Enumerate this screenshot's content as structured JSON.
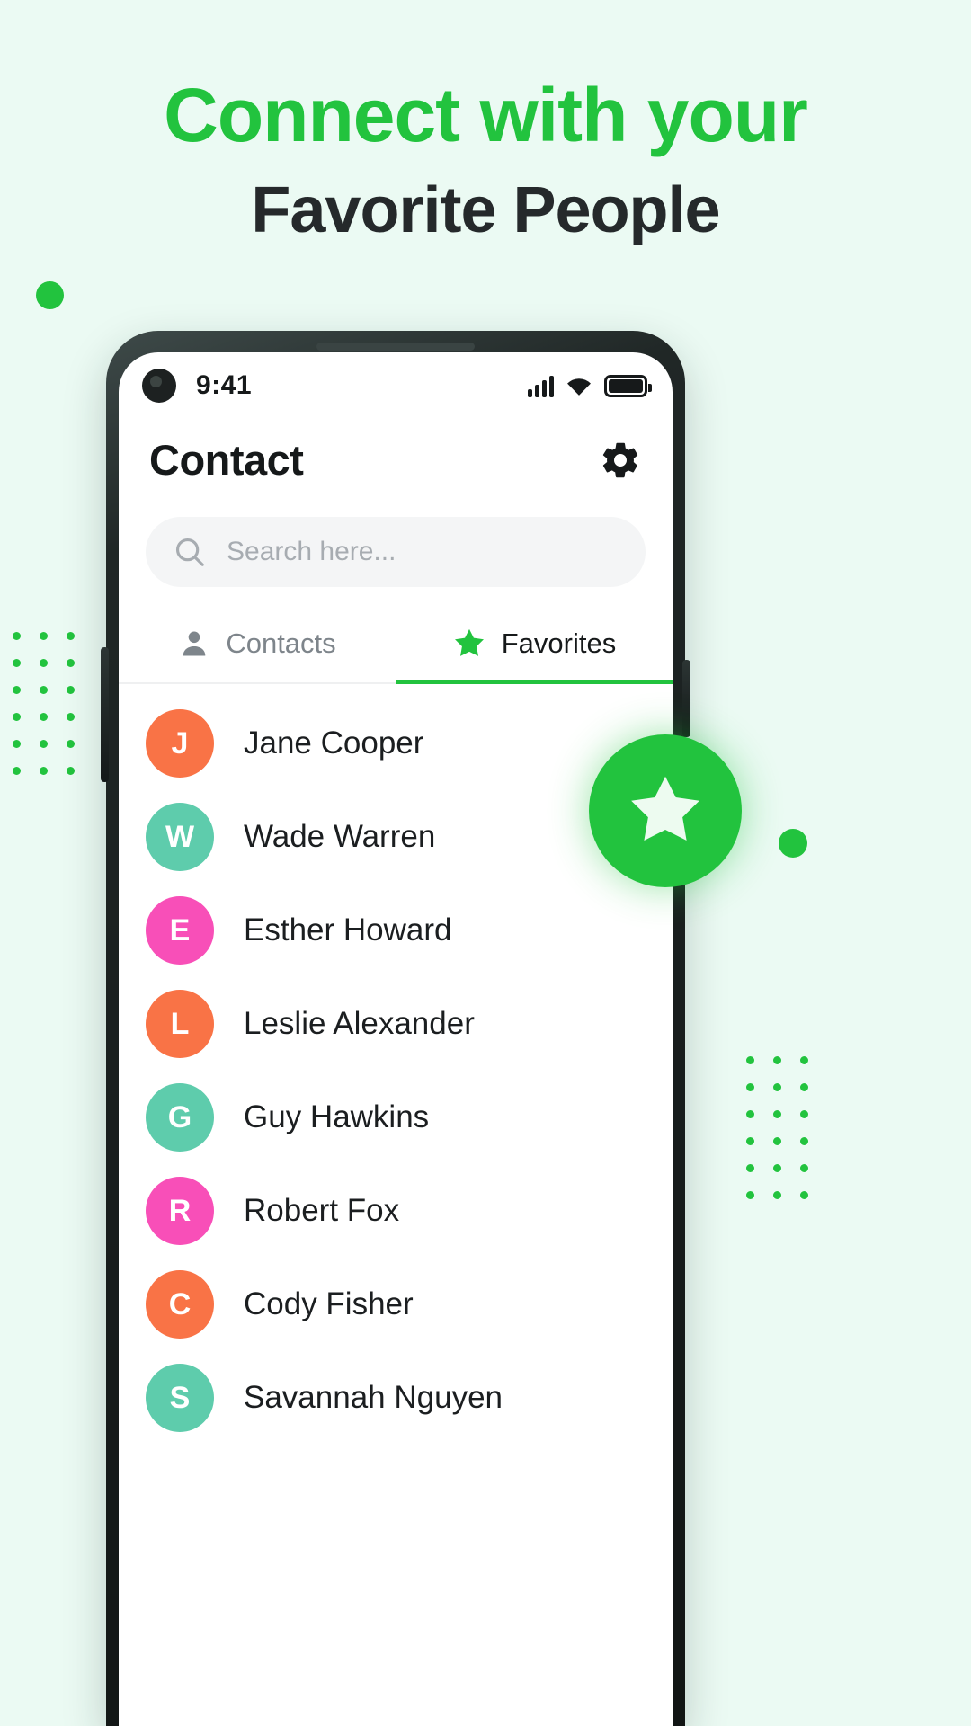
{
  "colors": {
    "background": "#EBFAF3",
    "brand_green": "#22C33E",
    "headline_dark": "#25292B",
    "avatar_orange": "#F97346",
    "avatar_teal": "#5ECCAC",
    "avatar_pink": "#F84FB8"
  },
  "headline": {
    "line1": "Connect with your",
    "line2": "Favorite People"
  },
  "phone": {
    "status_bar": {
      "time": "9:41",
      "signal_icon": "signal-bars-icon",
      "wifi_icon": "wifi-icon",
      "battery_icon": "battery-full-icon"
    },
    "header": {
      "title": "Contact",
      "settings_icon": "gear-icon"
    },
    "search": {
      "placeholder": "Search here...",
      "value": "",
      "icon": "search-icon"
    },
    "tabs": [
      {
        "label": "Contacts",
        "icon": "person-icon",
        "active": false
      },
      {
        "label": "Favorites",
        "icon": "star-icon",
        "active": true
      }
    ],
    "contacts": [
      {
        "initial": "J",
        "name": "Jane Cooper",
        "color": "#F97346"
      },
      {
        "initial": "W",
        "name": "Wade Warren",
        "color": "#5ECCAC"
      },
      {
        "initial": "E",
        "name": "Esther Howard",
        "color": "#F84FB8"
      },
      {
        "initial": "L",
        "name": "Leslie Alexander",
        "color": "#F97346"
      },
      {
        "initial": "G",
        "name": "Guy Hawkins",
        "color": "#5ECCAC"
      },
      {
        "initial": "R",
        "name": "Robert Fox",
        "color": "#F84FB8"
      },
      {
        "initial": "C",
        "name": "Cody Fisher",
        "color": "#F97346"
      },
      {
        "initial": "S",
        "name": "Savannah Nguyen",
        "color": "#5ECCAC"
      }
    ],
    "fab": {
      "icon": "star-icon"
    }
  }
}
